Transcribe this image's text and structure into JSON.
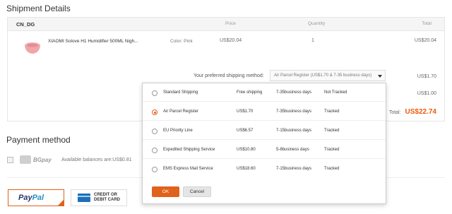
{
  "page": {
    "shipping_title": "Shipment Details",
    "payment_title": "Payment method"
  },
  "order": {
    "store_name": "CN_DG",
    "columns": {
      "price": "Price",
      "quantity": "Quantity",
      "total": "Total"
    },
    "product": {
      "name": "XIAOMI Solove H1 Humidifier 500ML Nigh...",
      "color": "Color: Pink",
      "price": "US$20.04",
      "quantity": "1",
      "total": "US$20.04"
    },
    "shipping_label": "Your preferred shipping method:",
    "shipping_selected": "Air Parcel Register (US$1.70 & 7-35 business days)",
    "shipping_cost": "US$1.70",
    "tax_cost": "US$1.00",
    "total_label": "Total:",
    "total_value": "US$22.74"
  },
  "shipping_options": [
    {
      "name": "Standard Shipping",
      "cost": "Free shipping",
      "time": "7-35business days",
      "tracking": "Not Tracked",
      "selected": false
    },
    {
      "name": "Air Parcel Register",
      "cost": "US$1.70",
      "time": "7-35business days",
      "tracking": "Tracked",
      "selected": true
    },
    {
      "name": "EU Priority Line",
      "cost": "US$6.57",
      "time": "7-15business days",
      "tracking": "Tracked",
      "selected": false
    },
    {
      "name": "Expedited Shipping Service",
      "cost": "US$10.80",
      "time": "5-8business days",
      "tracking": "Tracked",
      "selected": false
    },
    {
      "name": "EMS Express Mail Service",
      "cost": "US$18.60",
      "time": "7-15business days",
      "tracking": "Tracked",
      "selected": false
    }
  ],
  "dropdown_buttons": {
    "ok": "OK",
    "cancel": "Cancel"
  },
  "payment": {
    "bgpay_label": "BGpay",
    "balance_text": "Available balances are:US$0.81",
    "paypal_pay": "Pay",
    "paypal_pal": "Pal",
    "credit_line1": "CREDIT OR",
    "credit_line2": "DEBIT CARD"
  },
  "colors": {
    "accent": "#e0621b",
    "total": "#e85c0d",
    "paypal_dark": "#27346a",
    "paypal_light": "#2790c3"
  }
}
